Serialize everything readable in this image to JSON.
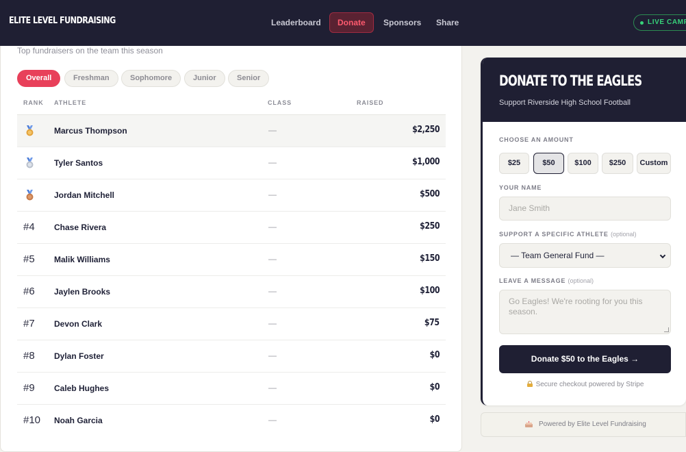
{
  "header": {
    "brand": "ELITE LEVEL FUNDRAISING",
    "nav": [
      {
        "label": "Leaderboard",
        "active": false
      },
      {
        "label": "Donate",
        "active": true
      },
      {
        "label": "Sponsors",
        "active": false
      },
      {
        "label": "Share",
        "active": false
      }
    ],
    "live_badge": "LIVE CAMPAIGN"
  },
  "leaderboard": {
    "subtitle": "Top fundraisers on the team this season",
    "filters": [
      {
        "label": "Overall",
        "active": true
      },
      {
        "label": "Freshman",
        "active": false
      },
      {
        "label": "Sophomore",
        "active": false
      },
      {
        "label": "Junior",
        "active": false
      },
      {
        "label": "Senior",
        "active": false
      }
    ],
    "columns": {
      "rank": "RANK",
      "athlete": "ATHLETE",
      "class": "CLASS",
      "raised": "RAISED"
    },
    "rows": [
      {
        "rank": "",
        "medal": "gold-medal-icon",
        "name": "Marcus Thompson",
        "class": "—",
        "raised": "$2,250"
      },
      {
        "rank": "",
        "medal": "silver-medal-icon",
        "name": "Tyler Santos",
        "class": "—",
        "raised": "$1,000"
      },
      {
        "rank": "",
        "medal": "bronze-medal-icon",
        "name": "Jordan Mitchell",
        "class": "—",
        "raised": "$500"
      },
      {
        "rank": "#4",
        "medal": "",
        "name": "Chase Rivera",
        "class": "—",
        "raised": "$250"
      },
      {
        "rank": "#5",
        "medal": "",
        "name": "Malik Williams",
        "class": "—",
        "raised": "$150"
      },
      {
        "rank": "#6",
        "medal": "",
        "name": "Jaylen Brooks",
        "class": "—",
        "raised": "$100"
      },
      {
        "rank": "#7",
        "medal": "",
        "name": "Devon Clark",
        "class": "—",
        "raised": "$75"
      },
      {
        "rank": "#8",
        "medal": "",
        "name": "Dylan Foster",
        "class": "—",
        "raised": "$0"
      },
      {
        "rank": "#9",
        "medal": "",
        "name": "Caleb Hughes",
        "class": "—",
        "raised": "$0"
      },
      {
        "rank": "#10",
        "medal": "",
        "name": "Noah Garcia",
        "class": "—",
        "raised": "$0"
      }
    ]
  },
  "donate": {
    "title": "DONATE TO THE EAGLES",
    "subtitle": "Support Riverside High School Football",
    "amount_label": "CHOOSE AN AMOUNT",
    "amounts": [
      {
        "label": "$25",
        "selected": false
      },
      {
        "label": "$50",
        "selected": true
      },
      {
        "label": "$100",
        "selected": false
      },
      {
        "label": "$250",
        "selected": false
      },
      {
        "label": "Custom",
        "selected": false
      }
    ],
    "name_label": "YOUR NAME",
    "name_placeholder": "Jane Smith",
    "athlete_label": "SUPPORT A SPECIFIC ATHLETE",
    "athlete_optional": "(optional)",
    "athlete_selected": "— Team General Fund —",
    "message_label": "LEAVE A MESSAGE",
    "message_optional": "(optional)",
    "message_placeholder": "Go Eagles! We're rooting for you this season.",
    "cta": "Donate $50 to the Eagles →",
    "secure_note": "Secure checkout powered by Stripe"
  },
  "footer": {
    "powered": "Powered by Elite Level Fundraising"
  },
  "colors": {
    "navy": "#1f1f33",
    "accent": "#e8405a",
    "live_green": "#37d27a",
    "gold": "#e3a23b",
    "silver": "#b9c0cc",
    "bronze": "#c57a4a"
  }
}
